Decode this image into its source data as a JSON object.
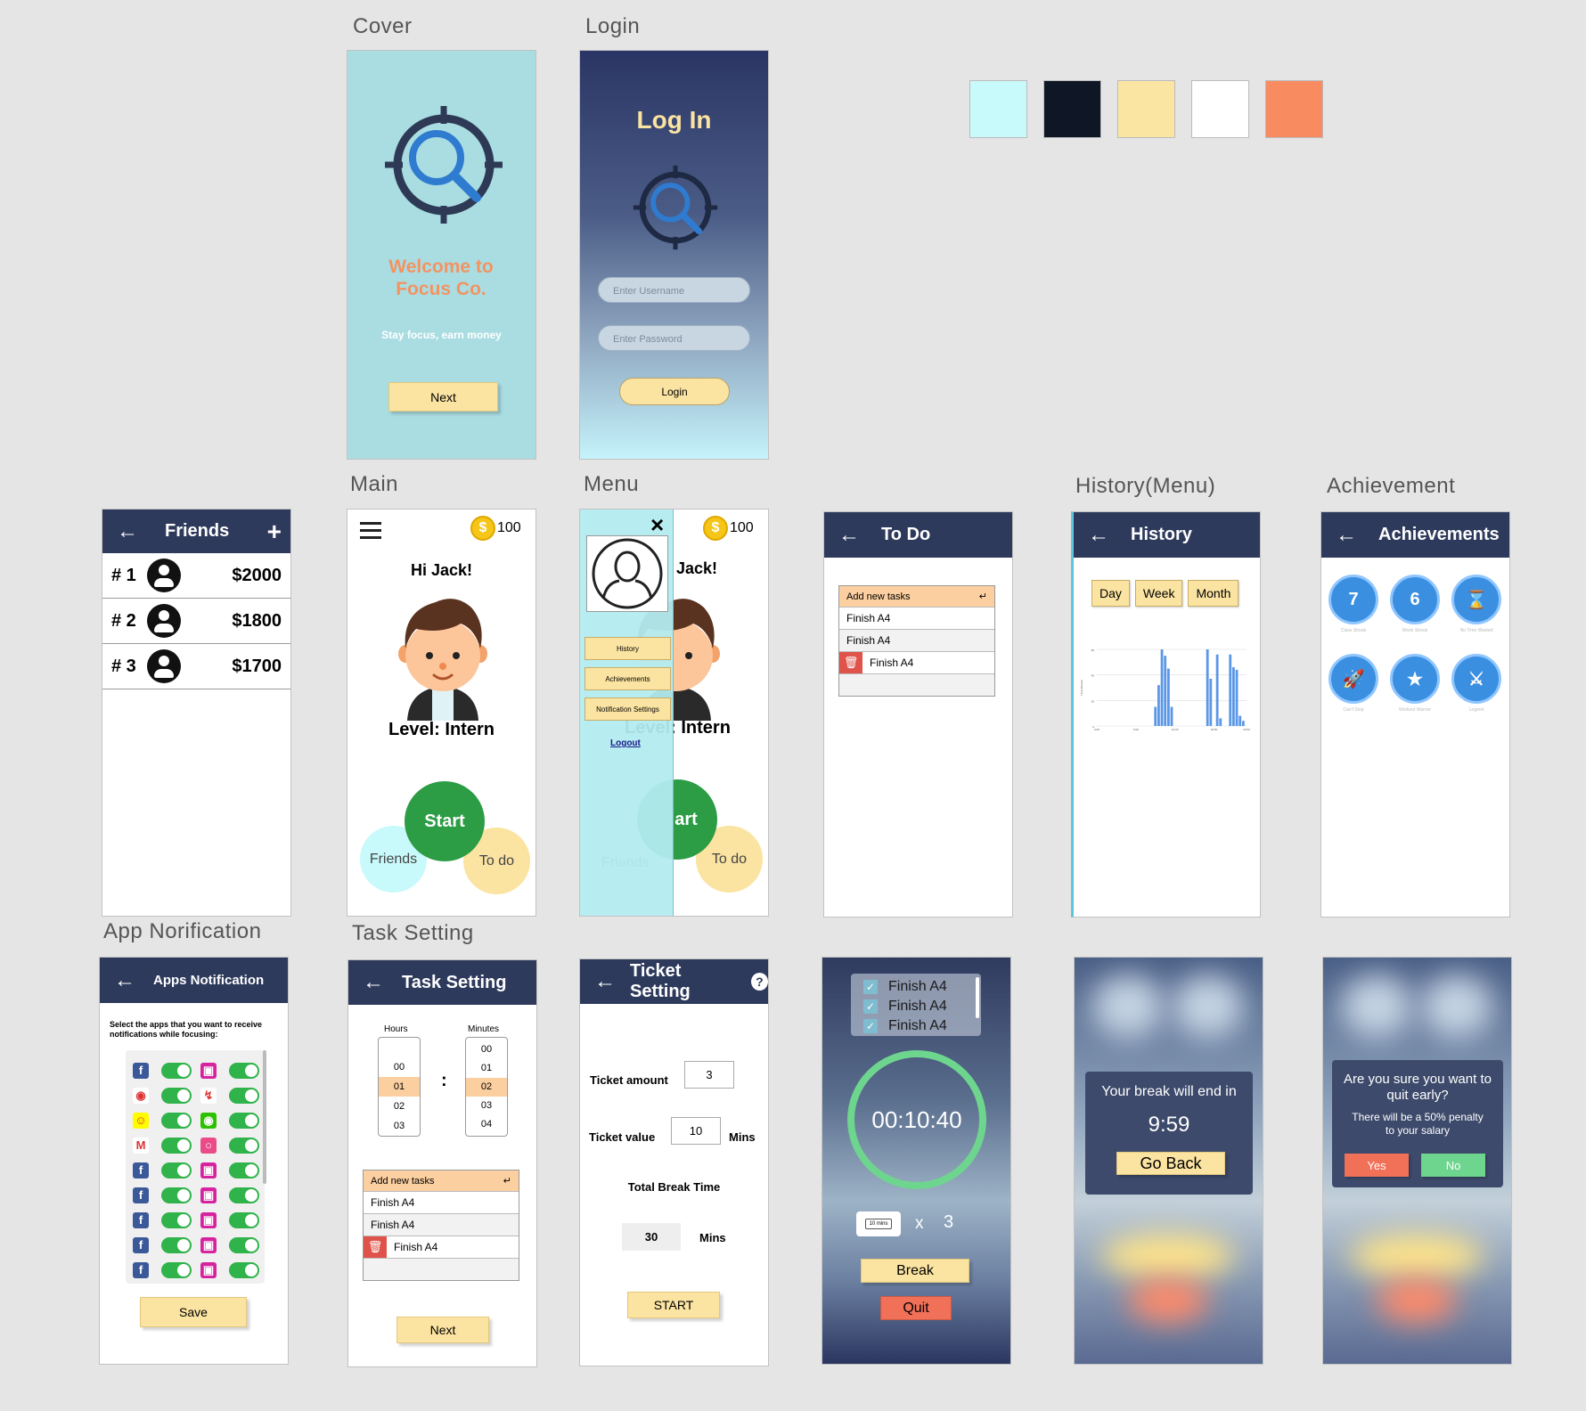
{
  "captions": {
    "cover": "Cover",
    "login": "Login",
    "main": "Main",
    "menu": "Menu",
    "history_menu": "History(Menu)",
    "achievement": "Achievement",
    "app_notification": "App Norification",
    "task_setting": "Task Setting"
  },
  "palette": [
    "#c8f9fb",
    "#0f1626",
    "#fbe5a3",
    "#ffffff",
    "#f88c60"
  ],
  "cover": {
    "title": "Welcome to Focus Co.",
    "tagline": "Stay focus, earn money",
    "next": "Next"
  },
  "login": {
    "title": "Log In",
    "username_placeholder": "Enter Username",
    "password_placeholder": "Enter Password",
    "button": "Login"
  },
  "friends": {
    "title": "Friends",
    "rows": [
      {
        "rank": "# 1",
        "amount": "$2000"
      },
      {
        "rank": "# 2",
        "amount": "$1800"
      },
      {
        "rank": "# 3",
        "amount": "$1700"
      }
    ]
  },
  "main": {
    "coins": "100",
    "greeting": "Hi Jack!",
    "level": "Level: Intern",
    "start": "Start",
    "friends": "Friends",
    "todo": "To do"
  },
  "menu": {
    "coins": "100",
    "greeting_partial": "Jack!",
    "level_partial": "Level: Intern",
    "start_partial": "art",
    "friends": "Friends",
    "todo": "To do",
    "items": [
      "History",
      "Achievements",
      "Notification Settings"
    ],
    "logout": "Logout"
  },
  "todo_screen": {
    "title": "To Do",
    "add": "Add new tasks",
    "tasks": [
      "Finish A4",
      "Finish A4",
      "Finish A4"
    ]
  },
  "history": {
    "title": "History",
    "tabs": [
      "Day",
      "Week",
      "Month"
    ],
    "ylabel": "Time Minutes",
    "yticks": [
      "60",
      "40",
      "20",
      "0"
    ],
    "xticks": [
      "0:00",
      "6:00",
      "12:00",
      "18:00",
      "23:00"
    ]
  },
  "chart_data": {
    "type": "bar",
    "ylabel": "Time Minutes",
    "ylim": [
      0,
      60
    ],
    "x": [
      "9:00",
      "9:30",
      "10:00",
      "10:30",
      "11:00",
      "11:30",
      "12:00",
      "12:30",
      "13:00",
      "17:00",
      "17:30",
      "18:00",
      "18:30",
      "19:00",
      "20:30",
      "21:00",
      "21:30",
      "22:00",
      "22:30"
    ],
    "values": [
      15,
      32,
      60,
      55,
      45,
      15,
      0,
      0,
      0,
      60,
      37,
      0,
      56,
      6,
      56,
      46,
      44,
      8,
      4
    ]
  },
  "achievements": {
    "title": "Achievements",
    "items": [
      "Class Streak",
      "Week Streak",
      "No Time Wasted",
      "Can't Stop",
      "Workout Warrior",
      "Legend"
    ]
  },
  "apps_notification": {
    "title": "Apps Notification",
    "instruction": "Select the apps that you want to receive notifications while focusing:",
    "save": "Save"
  },
  "task_setting": {
    "title": "Task Setting",
    "hours_label": "Hours",
    "minutes_label": "Minutes",
    "hours": [
      "00",
      "01",
      "02",
      "03"
    ],
    "minutes": [
      "00",
      "01",
      "02",
      "03",
      "04"
    ],
    "add": "Add new tasks",
    "tasks": [
      "Finish A4",
      "Finish A4",
      "Finish A4"
    ],
    "next": "Next"
  },
  "ticket_setting": {
    "title": "Ticket Setting",
    "amount_label": "Ticket amount",
    "amount": "3",
    "value_label": "Ticket value",
    "value": "10",
    "mins": "Mins",
    "total_label": "Total Break Time",
    "total": "30",
    "start": "START"
  },
  "timer": {
    "tasks": [
      "Finish A4",
      "Finish A4",
      "Finish A4"
    ],
    "time": "00:10:40",
    "ticket": "10 mins",
    "multiplier": "x",
    "count": "3",
    "break": "Break",
    "quit": "Quit"
  },
  "break_screen": {
    "message": "Your break will end in",
    "time": "9:59",
    "back": "Go Back"
  },
  "quit_screen": {
    "question": "Are you sure you want to quit early?",
    "warning": "There will be a 50% penalty to your salary",
    "yes": "Yes",
    "no": "No"
  }
}
